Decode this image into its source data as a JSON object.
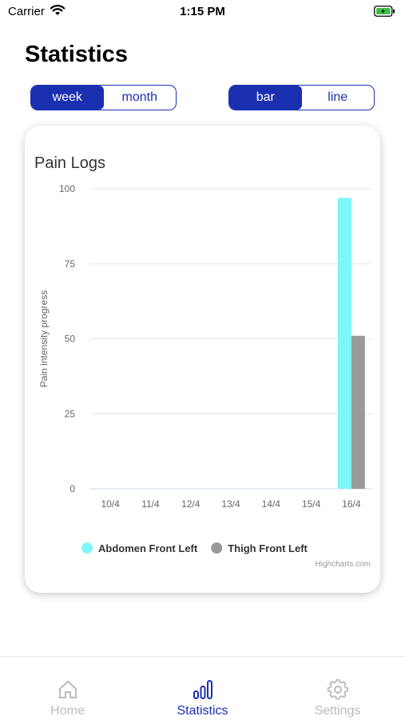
{
  "status_bar": {
    "carrier": "Carrier",
    "time": "1:15 PM"
  },
  "header": {
    "title": "Statistics"
  },
  "period_toggle": {
    "options": [
      "week",
      "month"
    ],
    "selected": "week"
  },
  "chart_type_toggle": {
    "options": [
      "bar",
      "line"
    ],
    "selected": "bar"
  },
  "chart_card": {
    "credit": "Highcharts.com"
  },
  "chart_data": {
    "type": "bar",
    "title": "Pain Logs",
    "xlabel": "",
    "ylabel": "Pain intensity progress",
    "categories": [
      "10/4",
      "11/4",
      "12/4",
      "13/4",
      "14/4",
      "15/4",
      "16/4"
    ],
    "ylim": [
      0,
      100
    ],
    "yticks": [
      0,
      25,
      50,
      75,
      100
    ],
    "series": [
      {
        "name": "Abdomen Front Left",
        "color": "#7df7fb",
        "values": [
          0,
          0,
          0,
          0,
          0,
          0,
          97
        ]
      },
      {
        "name": "Thigh Front Left",
        "color": "#9a9a9a",
        "values": [
          0,
          0,
          0,
          0,
          0,
          0,
          51
        ]
      }
    ],
    "legend": "bottom-center",
    "grid": true
  },
  "tab_bar": {
    "items": [
      {
        "label": "Home",
        "icon": "home-icon",
        "active": false
      },
      {
        "label": "Statistics",
        "icon": "bar-chart-icon",
        "active": true
      },
      {
        "label": "Settings",
        "icon": "gear-icon",
        "active": false
      }
    ]
  },
  "colors": {
    "accent": "#1a2fb0"
  }
}
